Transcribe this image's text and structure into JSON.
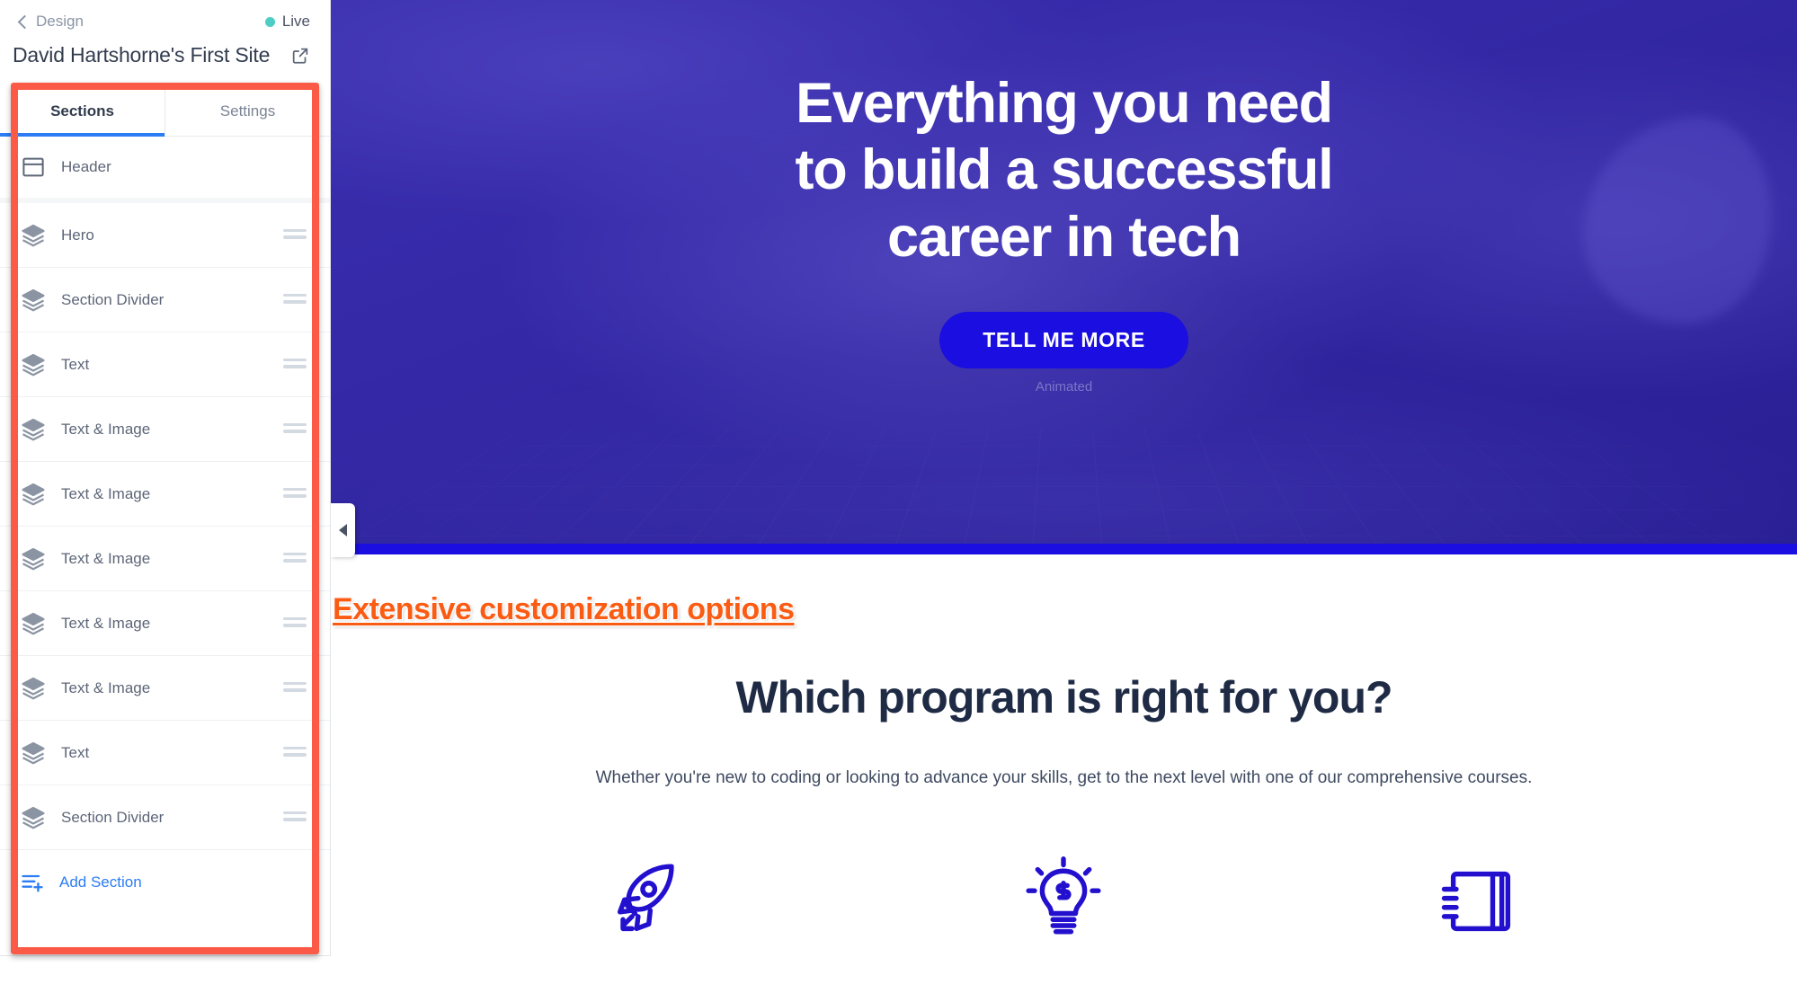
{
  "panel": {
    "back_label": "Design",
    "status_label": "Live",
    "status_color": "#4ecdc4",
    "site_title": "David Hartshorne's First Site",
    "external_link_icon": "external-link-icon",
    "tabs": [
      {
        "label": "Sections",
        "active": true
      },
      {
        "label": "Settings",
        "active": false
      }
    ],
    "sections": [
      {
        "label": "Header",
        "icon": "layout-icon",
        "draggable": false
      },
      {
        "label": "Hero",
        "icon": "layers-icon",
        "draggable": true
      },
      {
        "label": "Section Divider",
        "icon": "layers-icon",
        "draggable": true
      },
      {
        "label": "Text",
        "icon": "layers-icon",
        "draggable": true
      },
      {
        "label": "Text & Image",
        "icon": "layers-icon",
        "draggable": true
      },
      {
        "label": "Text & Image",
        "icon": "layers-icon",
        "draggable": true
      },
      {
        "label": "Text & Image",
        "icon": "layers-icon",
        "draggable": true
      },
      {
        "label": "Text & Image",
        "icon": "layers-icon",
        "draggable": true
      },
      {
        "label": "Text & Image",
        "icon": "layers-icon",
        "draggable": true
      },
      {
        "label": "Text",
        "icon": "layers-icon",
        "draggable": true
      },
      {
        "label": "Section Divider",
        "icon": "layers-icon",
        "draggable": true
      }
    ],
    "add_section_label": "Add Section",
    "add_section_icon": "list-plus-icon",
    "highlight_color": "#fa5a46",
    "accent_color": "#2b7cf5"
  },
  "preview": {
    "collapse_icon": "triangle-left-icon",
    "hero": {
      "title": "Everything you need to build a successful career in tech",
      "title_lines": [
        "Everything you need",
        "to build a successful",
        "career in tech"
      ],
      "cta_label": "TELL ME MORE",
      "cta_caption": "Animated",
      "cta_color": "#1a0ee0",
      "background_color": "#2e22a0"
    },
    "annotation": {
      "text": "Extensive customization options",
      "color": "#fb5c13"
    },
    "section": {
      "heading": "Which program is right for you?",
      "subtext": "Whether you're new to coding or looking to advance your skills, get to the next level with one of our comprehensive courses.",
      "heading_color": "#1f2b44",
      "icons": [
        {
          "name": "rocket-icon",
          "color": "#2310cf"
        },
        {
          "name": "lightbulb-dollar-icon",
          "color": "#2310cf"
        },
        {
          "name": "notebook-icon",
          "color": "#2310cf"
        }
      ]
    }
  }
}
